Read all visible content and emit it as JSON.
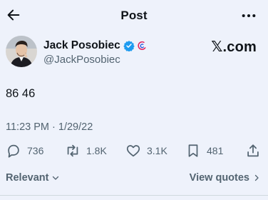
{
  "header": {
    "title": "Post",
    "back_icon": "arrow-left-icon",
    "more_icon": "more-horizontal-icon"
  },
  "author": {
    "name": "Jack Posobiec",
    "handle": "@JackPosobiec",
    "verified_color": "#1d9bf0",
    "affiliation_color": "#e0245e"
  },
  "brand": "𝕏.com",
  "tweet": {
    "text": "86 46",
    "timestamp": "11:23 PM · 1/29/22"
  },
  "actions": {
    "replies": "736",
    "reposts": "1.8K",
    "likes": "3.1K",
    "bookmarks": "481"
  },
  "footer": {
    "sort_label": "Relevant",
    "quotes_label": "View quotes"
  }
}
